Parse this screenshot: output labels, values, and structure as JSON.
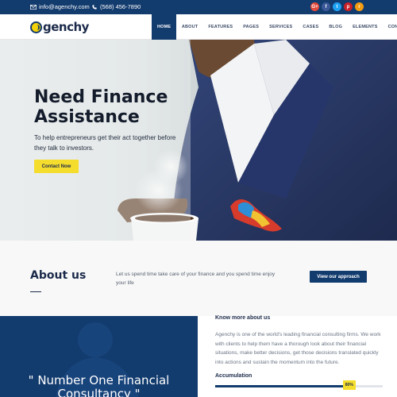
{
  "topbar": {
    "email": "info@agenchy.com",
    "phone": "(568) 456-7890",
    "social": [
      {
        "name": "google-plus-icon",
        "glyph": "G+",
        "color": "#e24a3b"
      },
      {
        "name": "facebook-icon",
        "glyph": "f",
        "color": "#3b5998"
      },
      {
        "name": "twitter-icon",
        "glyph": "t",
        "color": "#1da1f2"
      },
      {
        "name": "pinterest-icon",
        "glyph": "p",
        "color": "#cb2027"
      },
      {
        "name": "rss-icon",
        "glyph": "r",
        "color": "#f39c12"
      }
    ]
  },
  "brand": {
    "name": "Agenchy",
    "text": "genchy"
  },
  "nav": {
    "items": [
      {
        "label": "HOME",
        "active": true
      },
      {
        "label": "ABOUT"
      },
      {
        "label": "FEATURES"
      },
      {
        "label": "PAGES"
      },
      {
        "label": "SERVICES"
      },
      {
        "label": "CASES"
      },
      {
        "label": "BLOG"
      },
      {
        "label": "ELEMENTS"
      },
      {
        "label": "CONTACT"
      }
    ]
  },
  "hero": {
    "title_line1": "Need Finance",
    "title_line2": "Assistance",
    "subtitle": "To help entrepreneurs get their act together before they talk to investors.",
    "cta": "Contact Now"
  },
  "about": {
    "title": "About us",
    "text": "Let us spend time take care of your finance and you spend time enjoy your life",
    "button": "View our approach"
  },
  "quote": {
    "line1": "\" Number One Financial",
    "line2": "Consultancy \""
  },
  "know_more": {
    "title": "Know more about us",
    "text": "Agenchy is one of the world's leading financial consulting firms. We work with clients to help them have a thorough look about their financial situations, make better decisions, get those decisions translated quickly into actions and sustain the momentum into the future."
  },
  "accumulation": {
    "label": "Accumulation",
    "value": 0.8,
    "display": "80%"
  },
  "colors": {
    "primary": "#123b6e",
    "accent": "#f5dd2e"
  }
}
